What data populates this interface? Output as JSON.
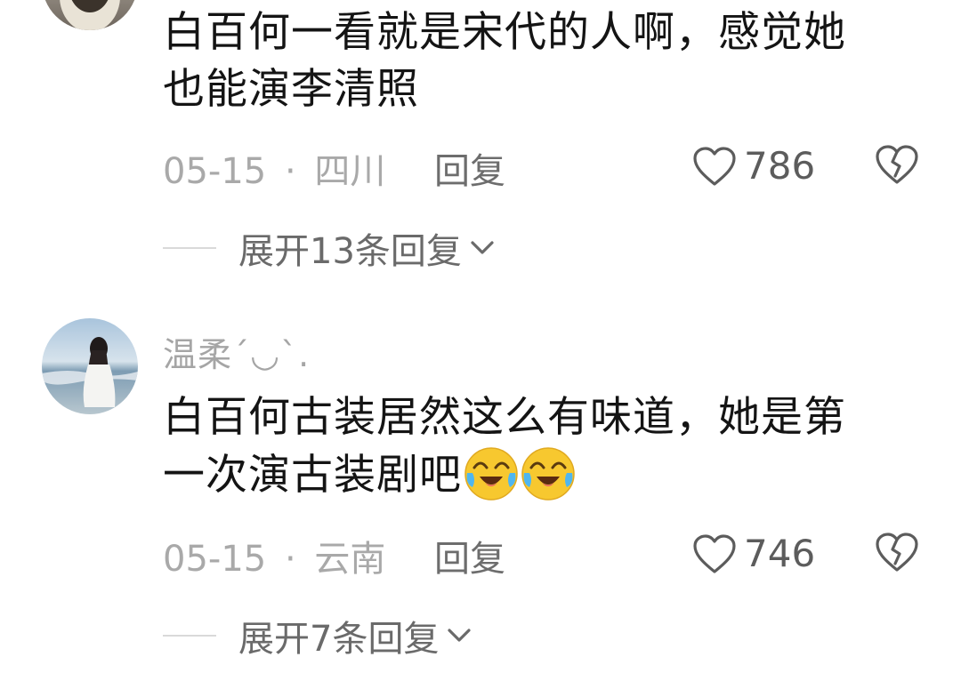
{
  "comments": [
    {
      "content_lines": [
        "白百何一看就是宋代的人啊，感觉她",
        "也能演李清照"
      ],
      "date": "05-15",
      "location": "四川",
      "separator": "·",
      "reply_label": "回复",
      "likes": "786",
      "expand_label": "展开13条回复"
    },
    {
      "username": "温柔´◡`.",
      "content_lines": [
        "白百何古装居然这么有味道，她是第",
        "一次演古装剧吧"
      ],
      "emojis": [
        "crying-laughing-emoji",
        "crying-laughing-emoji"
      ],
      "date": "05-15",
      "location": "云南",
      "separator": "·",
      "reply_label": "回复",
      "likes": "746",
      "expand_label": "展开7条回复"
    }
  ],
  "icons": {
    "like": "heart-outline-icon",
    "dislike": "broken-heart-icon",
    "expand": "chevron-down-icon"
  },
  "colors": {
    "text": "#141414",
    "username": "#a5a5a5",
    "meta": "#a9a9a9",
    "reply": "#6d6d6d",
    "emoji": "#f7c82f"
  }
}
